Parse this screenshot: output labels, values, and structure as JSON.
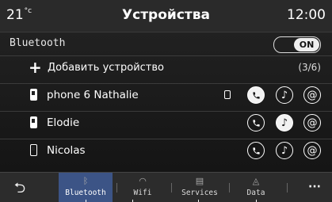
{
  "status_bar": {
    "temperature": "21",
    "unit": "°c",
    "title": "Устройства",
    "time": "12:00"
  },
  "bluetooth": {
    "label": "Bluetooth",
    "toggle_state": "ON"
  },
  "add_device": {
    "plus": "+",
    "label": "Добавить устройство",
    "count": "(3/6)"
  },
  "devices": [
    {
      "name": "phone 6 Nathalie",
      "active_device": true,
      "phone_active": true,
      "music_active": false,
      "data_active": false
    },
    {
      "name": "Elodie",
      "active_device": false,
      "phone_active": false,
      "music_active": true,
      "data_active": false
    },
    {
      "name": "Nicolas",
      "active_device": false,
      "phone_active": false,
      "music_active": false,
      "data_active": false
    }
  ],
  "icons": {
    "phone": "phone-icon",
    "music": "music-note-icon",
    "data": "at-sign-icon"
  },
  "bottom_bar": {
    "back_glyph": "⮌",
    "tabs": [
      {
        "label": "Bluetooth",
        "icon": "bluetooth-icon",
        "active": true
      },
      {
        "label": "Wifi",
        "icon": "wifi-icon",
        "active": false
      },
      {
        "label": "Services",
        "icon": "services-icon",
        "active": false
      },
      {
        "label": "Data",
        "icon": "data-icon",
        "active": false
      }
    ],
    "more_glyph": "···"
  },
  "colors": {
    "active_tab": "#3c5486",
    "background": "#1a1a1a"
  }
}
